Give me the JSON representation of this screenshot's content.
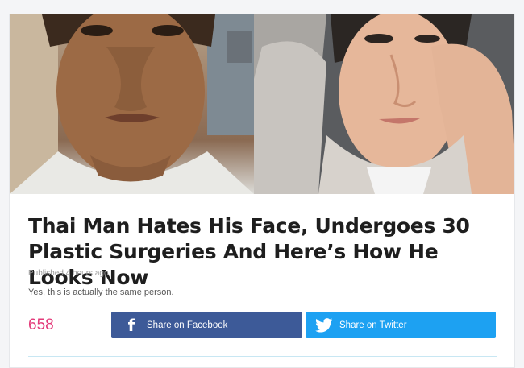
{
  "article": {
    "title": "Thai Man Hates His Face, Undergoes 30 Plastic Surgeries And Here’s How He Looks Now",
    "published": "Published 4 hours ago",
    "subtitle": "Yes, this is actually the same person."
  },
  "images": {
    "before_icon": "portrait-photo-icon",
    "after_icon": "portrait-photo-icon"
  },
  "share": {
    "count": "658",
    "facebook_label": "Share on Facebook",
    "twitter_label": "Share on Twitter",
    "facebook_color": "#3d5a98",
    "twitter_color": "#1da1f2",
    "count_color": "#e33b7a"
  }
}
